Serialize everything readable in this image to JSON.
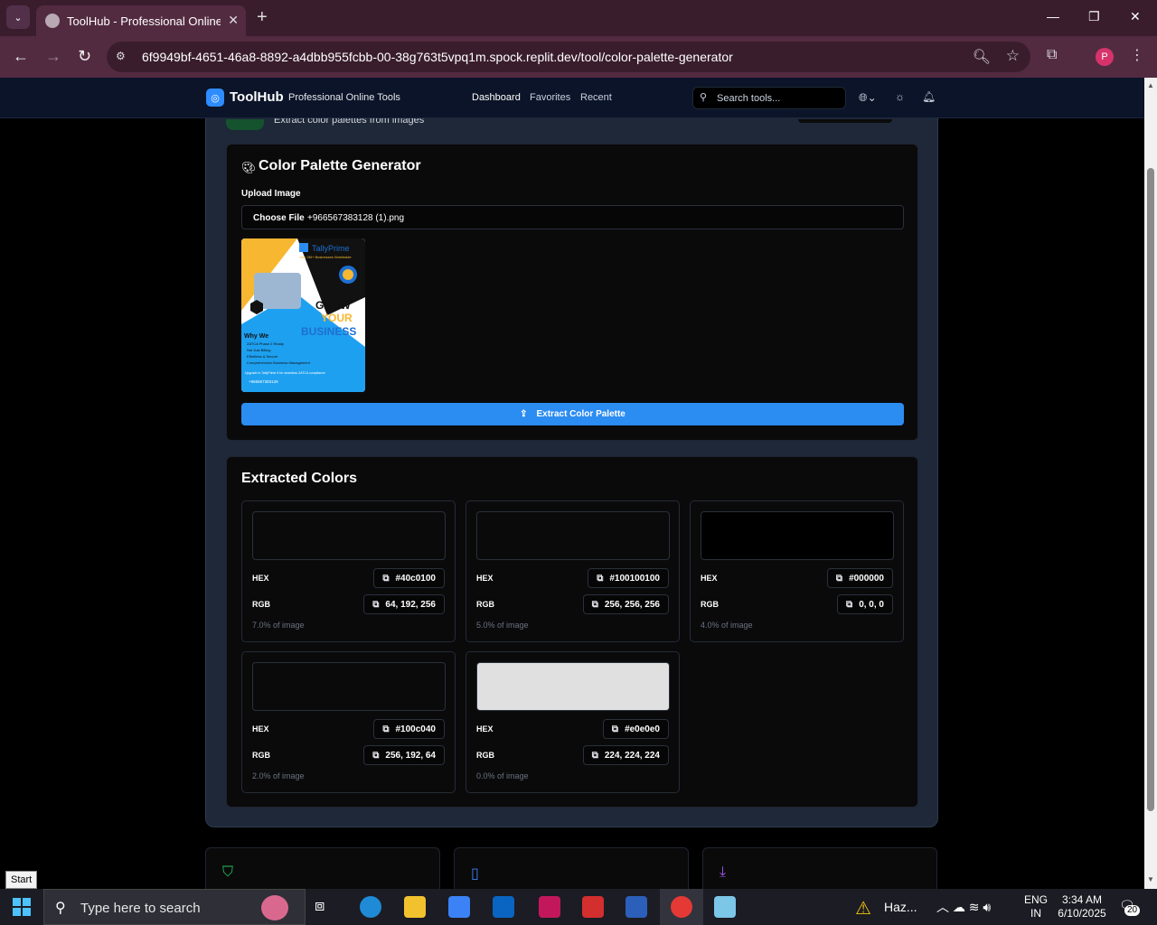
{
  "browser": {
    "tab_title": "ToolHub - Professional Online T",
    "url": "6f9949bf-4651-46a8-8892-a4dbb955fcbb-00-38g763t5vpq1m.spock.replit.dev/tool/color-palette-generator",
    "profile_initial": "P"
  },
  "header": {
    "app_name": "ToolHub",
    "tagline": "Professional Online Tools",
    "nav": [
      "Dashboard",
      "Favorites",
      "Recent"
    ],
    "search_placeholder": "Search tools..."
  },
  "prev_card": {
    "description": "Extract color palettes from images"
  },
  "generator": {
    "title": "Color Palette Generator",
    "upload_label": "Upload Image",
    "choose_file": "Choose File",
    "file_name": "+966567383128 (1).png",
    "extract_button": "Extract Color Palette",
    "preview": {
      "brand": "TallyPrime",
      "brand_sub": "Join 2M+ Businesses Worldwide",
      "headline_1": "GROW",
      "headline_2": "YOUR",
      "headline_3": "BUSINESS",
      "why": "Why We",
      "bullets": [
        "ZATCA Phase 2 Ready",
        "Not Just Billing",
        "Effortless & Secure",
        "Comprehensive Business Management"
      ],
      "upgrade": "Upgrade to TallyPrime 6 for seamless ZATCA compliance",
      "phone": "+966567383128"
    }
  },
  "extracted": {
    "title": "Extracted Colors",
    "hex_label": "HEX",
    "rgb_label": "RGB",
    "colors": [
      {
        "hex": "#40c0100",
        "rgb": "64, 192, 256",
        "pct": "7.0% of image",
        "swatch": "#0a0a0b"
      },
      {
        "hex": "#100100100",
        "rgb": "256, 256, 256",
        "pct": "5.0% of image",
        "swatch": "#0a0a0b"
      },
      {
        "hex": "#000000",
        "rgb": "0, 0, 0",
        "pct": "4.0% of image",
        "swatch": "#000000"
      },
      {
        "hex": "#100c040",
        "rgb": "256, 192, 64",
        "pct": "2.0% of image",
        "swatch": "#0a0a0b"
      },
      {
        "hex": "#e0e0e0",
        "rgb": "224, 224, 224",
        "pct": "0.0% of image",
        "swatch": "#e0e0e0"
      }
    ]
  },
  "taskbar": {
    "start_tooltip": "Start",
    "search_text": "Type here to search",
    "weather": "Haz...",
    "lang_1": "ENG",
    "lang_2": "IN",
    "time": "3:34 AM",
    "date": "6/10/2025",
    "notif_count": "20"
  },
  "colors": {
    "accent": "#2b8cf2",
    "chrome_bg": "#532b41",
    "header_bg": "#0b1428"
  }
}
